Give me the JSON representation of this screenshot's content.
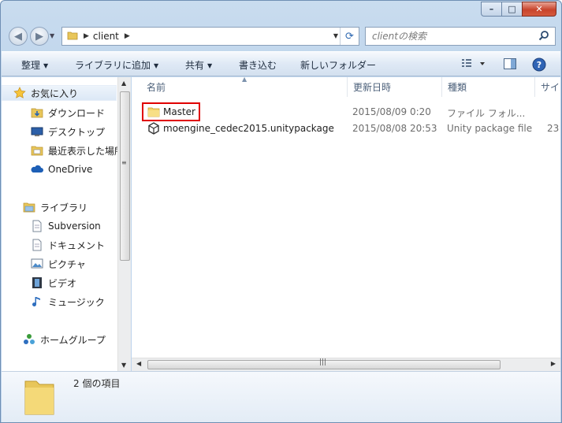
{
  "window": {
    "caption_buttons": {
      "minimize": "–",
      "maximize": "□",
      "close": "✕"
    }
  },
  "address": {
    "crumbs": [
      "client"
    ],
    "search_placeholder": "clientの検索"
  },
  "toolbar": {
    "organize": "整理",
    "add_to_library": "ライブラリに追加",
    "share": "共有",
    "burn": "書き込む",
    "new_folder": "新しいフォルダー"
  },
  "nav": {
    "favorites": "お気に入り",
    "favorites_items": [
      "ダウンロード",
      "デスクトップ",
      "最近表示した場所",
      "OneDrive"
    ],
    "libraries": "ライブラリ",
    "library_items": [
      "Subversion",
      "ドキュメント",
      "ピクチャ",
      "ビデオ",
      "ミュージック"
    ],
    "homegroup": "ホームグループ"
  },
  "columns": {
    "name": "名前",
    "date": "更新日時",
    "type": "種類",
    "size": "サイ"
  },
  "files": [
    {
      "name": "Master",
      "date": "2015/08/09 0:20",
      "type": "ファイル フォル...",
      "size": "",
      "icon": "folder-icon"
    },
    {
      "name": "moengine_cedec2015.unitypackage",
      "date": "2015/08/08 20:53",
      "type": "Unity package file",
      "size": "23",
      "icon": "unity-icon"
    }
  ],
  "status": {
    "item_count": "2 個の項目"
  },
  "colors": {
    "highlight": "#e00000",
    "folder": "#f3d46b",
    "accent": "#2b66b0"
  }
}
